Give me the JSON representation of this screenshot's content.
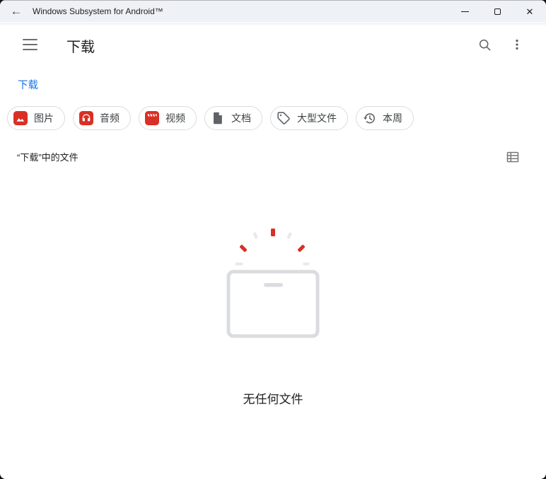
{
  "window": {
    "title": "Windows Subsystem for Android™"
  },
  "titlebar_icons": {
    "back": "←",
    "close": "✕"
  },
  "app_bar": {
    "title": "下载"
  },
  "breadcrumb": {
    "current": "下载"
  },
  "filters": [
    {
      "label": "图片",
      "icon": "image-icon",
      "icon_style": "red-badge"
    },
    {
      "label": "音频",
      "icon": "audio-icon",
      "icon_style": "red-badge"
    },
    {
      "label": "视频",
      "icon": "video-icon",
      "icon_style": "red-badge"
    },
    {
      "label": "文档",
      "icon": "document-icon",
      "icon_style": "gray"
    },
    {
      "label": "大型文件",
      "icon": "tag-icon",
      "icon_style": "gray-outline"
    },
    {
      "label": "本周",
      "icon": "history-icon",
      "icon_style": "gray-outline"
    }
  ],
  "file_section": {
    "label": "“下载”中的文件"
  },
  "empty_state": {
    "message": "无任何文件"
  },
  "colors": {
    "accent_red": "#d93025",
    "link_blue": "#1a73e8",
    "chip_border": "#dadce0",
    "icon_gray": "#5f6368",
    "illustration_gray": "#dadce0",
    "illustration_light_gray": "#e8eaed",
    "titlebar_bg": "#eef1f5"
  }
}
